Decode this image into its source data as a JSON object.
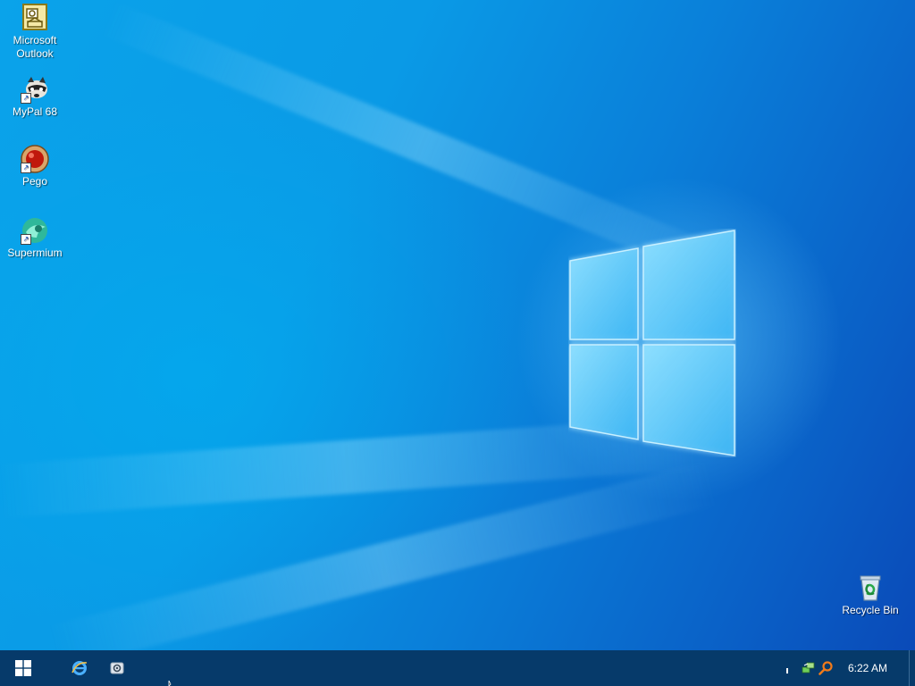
{
  "desktop": {
    "icons": [
      {
        "label": "Microsoft\nOutlook",
        "icon": "outlook-icon"
      },
      {
        "label": "MyPal 68",
        "icon": "mypal-raccoon-icon"
      },
      {
        "label": "Pego",
        "icon": "pego-red-ball-icon"
      },
      {
        "label": "Supermium",
        "icon": "supermium-icon"
      },
      {
        "label": "Recycle Bin",
        "icon": "recycle-bin-icon"
      }
    ],
    "wallpaper": {
      "primary": "#0a9ae6",
      "secondary": "#0a4ab8",
      "logo_glow": "#7fd6ff"
    }
  },
  "taskbar": {
    "background": "#063a6a",
    "start_icon": "windows-logo-icon",
    "pinned": [
      {
        "name": "Internet Explorer",
        "icon": "internet-explorer-icon"
      },
      {
        "name": "Settings",
        "icon": "settings-gear-icon"
      }
    ],
    "tray": {
      "overflow_icon": "tray-overflow-icon",
      "icons": [
        "network-icon",
        "search-magnifier-icon"
      ],
      "clock": "6:22 AM"
    }
  }
}
